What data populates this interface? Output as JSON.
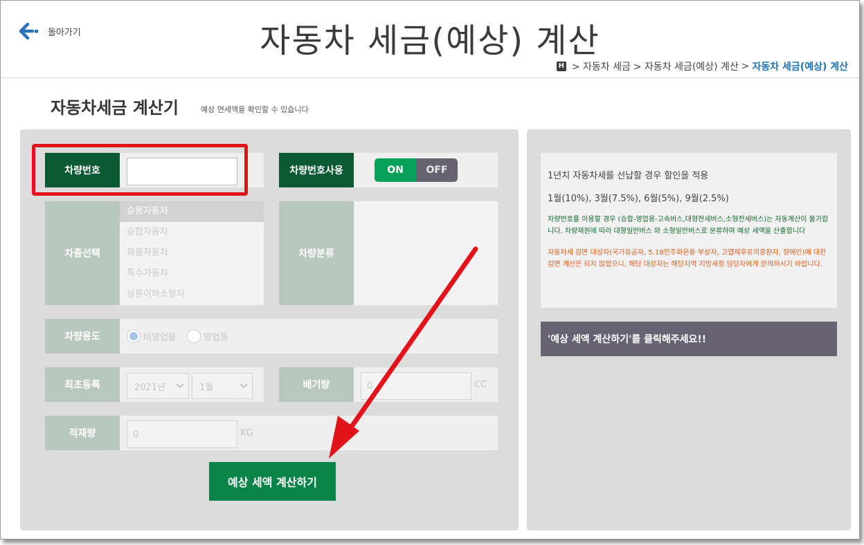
{
  "header": {
    "back_label": "돌아가기",
    "title": "자동차 세금(예상) 계산",
    "breadcrumb": {
      "home": "H",
      "items": [
        "> 자동차 세금",
        "> 자동차 세금(예상) 계산",
        ">"
      ],
      "current": "자동차 세금(예상) 계산"
    }
  },
  "section": {
    "title": "자동차세금 계산기",
    "subtitle": "예상 연세액을 확인할 수 있습니다"
  },
  "form": {
    "plate_label": "차량번호",
    "plate_value": "",
    "plate_use_label": "차량번호사용",
    "toggle_on": "ON",
    "toggle_off": "OFF",
    "car_type_label": "차종선택",
    "car_types": [
      "승용자동차",
      "승합자동차",
      "화물자동차",
      "특수자동차",
      "삼륜이하소형차"
    ],
    "car_class_label": "차량분류",
    "usage_label": "차량용도",
    "usage_options": [
      "비영업용",
      "영업용"
    ],
    "first_reg_label": "최초등록",
    "year_value": "2021년",
    "month_value": "1월",
    "displacement_label": "배기량",
    "displacement_value": "0",
    "displacement_unit": "CC",
    "load_label": "적재량",
    "load_value": "0",
    "load_unit": "KG",
    "calc_button": "예상 세액 계산하기"
  },
  "info": {
    "line1": "1년치 자동차세를 선납할 경우 할인을 적용",
    "line2": "1월(10%), 3월(7.5%), 6월(5%), 9월(2.5%)",
    "green_note": "차량번호를 이용할 경우 (승합-영업용-고속버스,대형전세버스,소형전세버스)는 자동계산이 불가합니다. 차량재원에 따라 대형일반버스 와 소형일반버스로 분류하여 예상 세액을 산출합니다",
    "orange_note": "자동차세 감면 대상자(국가유공자, 5.18민주화운동 부상자, 고엽제후유의증환자, 장애인)에 대한 감면 계산은 되지 않았으니, 해당 대상자는 해당지역 지방세정 담당자에게 문의하시기 바랍니다.",
    "hint": "'예상 세액 계산하기'를 클릭해주세요!!"
  },
  "colors": {
    "dark_green": "#0b5a34",
    "button_green": "#0a8449",
    "toggle_on": "#08a15a",
    "toggle_off": "#666270",
    "highlight_red": "#e2141b",
    "link_blue": "#1f74b8"
  }
}
